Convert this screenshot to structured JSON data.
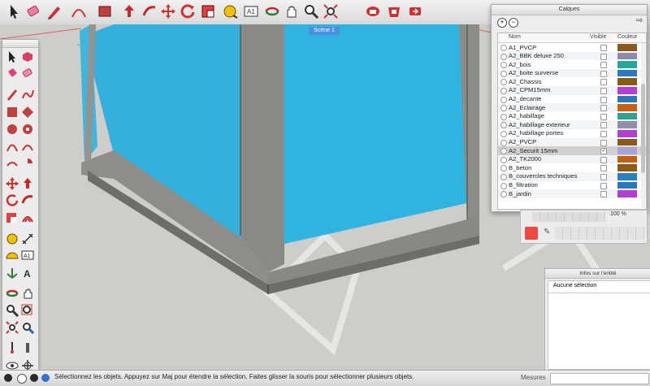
{
  "toolbar": {
    "icons": [
      "select-icon",
      "eraser-icon",
      "pencil-icon",
      "arc-icon",
      "rectangle-icon",
      "push-pull-icon",
      "follow-me-icon",
      "move-icon",
      "rotate-icon",
      "scale-icon",
      "tape-measure-icon",
      "text-icon",
      "orbit-icon",
      "pan-icon",
      "zoom-icon",
      "zoom-extents-icon",
      "warehouse-icon",
      "extension-icon"
    ]
  },
  "scene": {
    "tab_label": "Scène 1"
  },
  "layers_panel": {
    "title": "Calques",
    "col_name": "Nom",
    "col_visible": "Visible",
    "col_color": "Couleur",
    "rows": [
      {
        "name": "A1_PVCP",
        "color": "#8a5a1a",
        "visible": false
      },
      {
        "name": "A2_BBK deluxe 250",
        "color": "#8c8cab",
        "visible": false
      },
      {
        "name": "A2_bois",
        "color": "#25a89a",
        "visible": false
      },
      {
        "name": "A2_boite surverse",
        "color": "#2c79c2",
        "visible": false
      },
      {
        "name": "A2_Chassis",
        "color": "#8b5a12",
        "visible": false
      },
      {
        "name": "A2_CPM15mm",
        "color": "#b53fd6",
        "visible": false
      },
      {
        "name": "A2_decante",
        "color": "#2a78b8",
        "visible": false
      },
      {
        "name": "A2_Eclairage",
        "color": "#c96010",
        "visible": false
      },
      {
        "name": "A2_habillage",
        "color": "#2aa295",
        "visible": false
      },
      {
        "name": "A2_habillage exterieur",
        "color": "#8f8fa8",
        "visible": false
      },
      {
        "name": "A2_habillage portes",
        "color": "#b23fd0",
        "visible": false
      },
      {
        "name": "A2_PVCP",
        "color": "#8a5a14",
        "visible": false
      },
      {
        "name": "A2_Securit 15mm",
        "color": "#a8a4d8",
        "visible": true
      },
      {
        "name": "A2_TK2000",
        "color": "#c55e10",
        "visible": false
      },
      {
        "name": "B_beton",
        "color": "#8c5a14",
        "visible": false
      },
      {
        "name": "B_couvercles techniques",
        "color": "#2a7dc0",
        "visible": false
      },
      {
        "name": "B_filtration",
        "color": "#2a79bb",
        "visible": false
      },
      {
        "name": "B_jardin",
        "color": "#b33fd2",
        "visible": false
      }
    ]
  },
  "materials": {
    "opacity_value": "100 %"
  },
  "entity_info": {
    "title": "Infos sur l'entité",
    "text": "Aucune sélection"
  },
  "status": {
    "message": "Sélectionnez les objets. Appuyez sur Maj pour étendre la sélection. Faites glisser la souris pour sélectionner plusieurs objets.",
    "measures_label": "Mesures"
  }
}
